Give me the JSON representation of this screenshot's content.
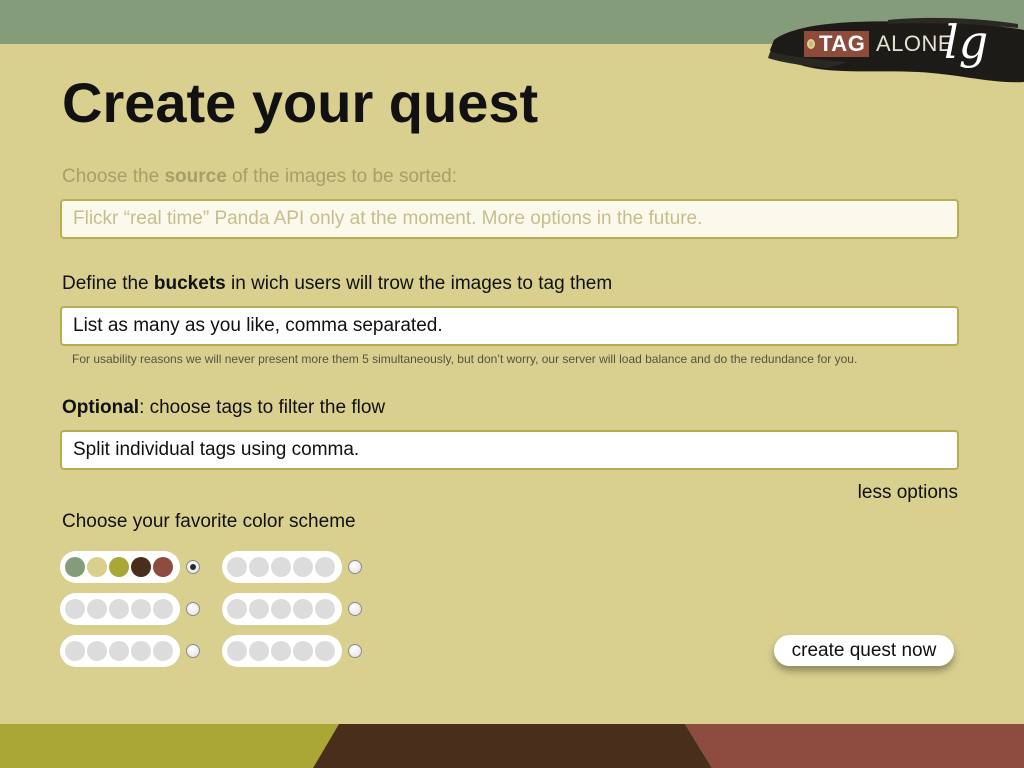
{
  "brand": {
    "tag": "TAG",
    "alone": "ALONE",
    "script": "lg"
  },
  "title": {
    "bold": "Create",
    "rest": " your quest"
  },
  "source": {
    "label_pre": "Choose the ",
    "label_bold": "source",
    "label_post": " of the images to be sorted:",
    "field_text": "Flickr “real time” Panda API only at the moment. More options in the future."
  },
  "buckets": {
    "label_pre": "Define the ",
    "label_bold": "buckets",
    "label_post": " in wich users will trow the images to tag them",
    "field_text": "List as many as you like, comma separated.",
    "hint": "For usability reasons we will never present more them 5 simultaneously, but don’t worry, our server will load balance and do the redundance for you."
  },
  "filter": {
    "label_bold": "Optional",
    "label_post": ": choose tags to filter the flow",
    "field_text": "Split individual tags using comma."
  },
  "less_options": "less options",
  "color_scheme": {
    "label": "Choose your favorite color scheme",
    "selected": 0,
    "schemes": [
      [
        "#849c79",
        "#d9d08f",
        "#aaa736",
        "#4a2e1c",
        "#8e4c40"
      ],
      [
        "#dcdcdc",
        "#dcdcdc",
        "#dcdcdc",
        "#dcdcdc",
        "#dcdcdc"
      ],
      [
        "#dcdcdc",
        "#dcdcdc",
        "#dcdcdc",
        "#dcdcdc",
        "#dcdcdc"
      ],
      [
        "#dcdcdc",
        "#dcdcdc",
        "#dcdcdc",
        "#dcdcdc",
        "#dcdcdc"
      ],
      [
        "#dcdcdc",
        "#dcdcdc",
        "#dcdcdc",
        "#dcdcdc",
        "#dcdcdc"
      ],
      [
        "#dcdcdc",
        "#dcdcdc",
        "#dcdcdc",
        "#dcdcdc",
        "#dcdcdc"
      ]
    ]
  },
  "create_button": "create quest now",
  "colors": {
    "topbar": "#849c79",
    "background": "#d9d08f",
    "footer_olive": "#aaa736",
    "footer_brown": "#4a2e1c",
    "footer_rust": "#8e4c40"
  }
}
